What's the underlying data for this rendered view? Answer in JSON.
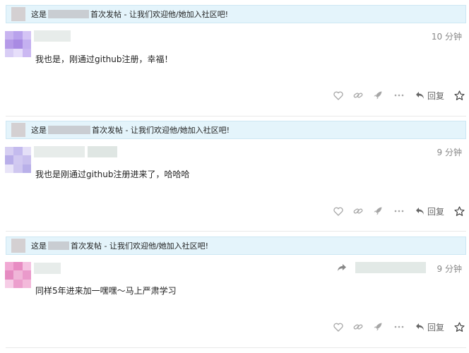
{
  "posts": [
    {
      "banner_prefix": "这是",
      "banner_suffix": "首次发帖 - 让我们欢迎他/她加入社区吧!",
      "time": "10 分钟",
      "content": "我也是，刚通过github注册，幸福！",
      "reply_label": "回复",
      "avatar_colors": [
        "#c8b4f0",
        "#b9a2ec",
        "#d4c4f5",
        "#b59ae8",
        "#a98be3",
        "#c4b0f0",
        "#d8cdf5",
        "#e6defa",
        "#cbb8f2"
      ]
    },
    {
      "banner_prefix": "这是",
      "banner_suffix": "首次发帖 - 让我们欢迎他/她加入社区吧!",
      "time": "9 分钟",
      "content": "我也是刚通过github注册进来了，哈哈哈",
      "reply_label": "回复",
      "avatar_colors": [
        "#d6cff2",
        "#c4bbee",
        "#e4dff7",
        "#b8aee9",
        "#d1c9f1",
        "#c9c0ee",
        "#e8e4f8",
        "#cfc7f0",
        "#b9b0e9"
      ]
    },
    {
      "banner_prefix": "这是",
      "banner_suffix": "首次发帖 - 让我们欢迎他/她加入社区吧!",
      "time": "9 分钟",
      "content": "同样5年进来加一嘿嘿～马上严肃学习",
      "reply_label": "回复",
      "avatar_colors": [
        "#f1a9d4",
        "#e88cc3",
        "#f5c2e1",
        "#e58bc1",
        "#f0b6d8",
        "#ea9acb",
        "#f6cde6",
        "#ec9fcd",
        "#f3b9da"
      ]
    }
  ],
  "icons": [
    "heart-icon",
    "link-icon",
    "rocket-icon",
    "more-icon",
    "reply-icon",
    "star-icon",
    "share-arrow-icon"
  ]
}
